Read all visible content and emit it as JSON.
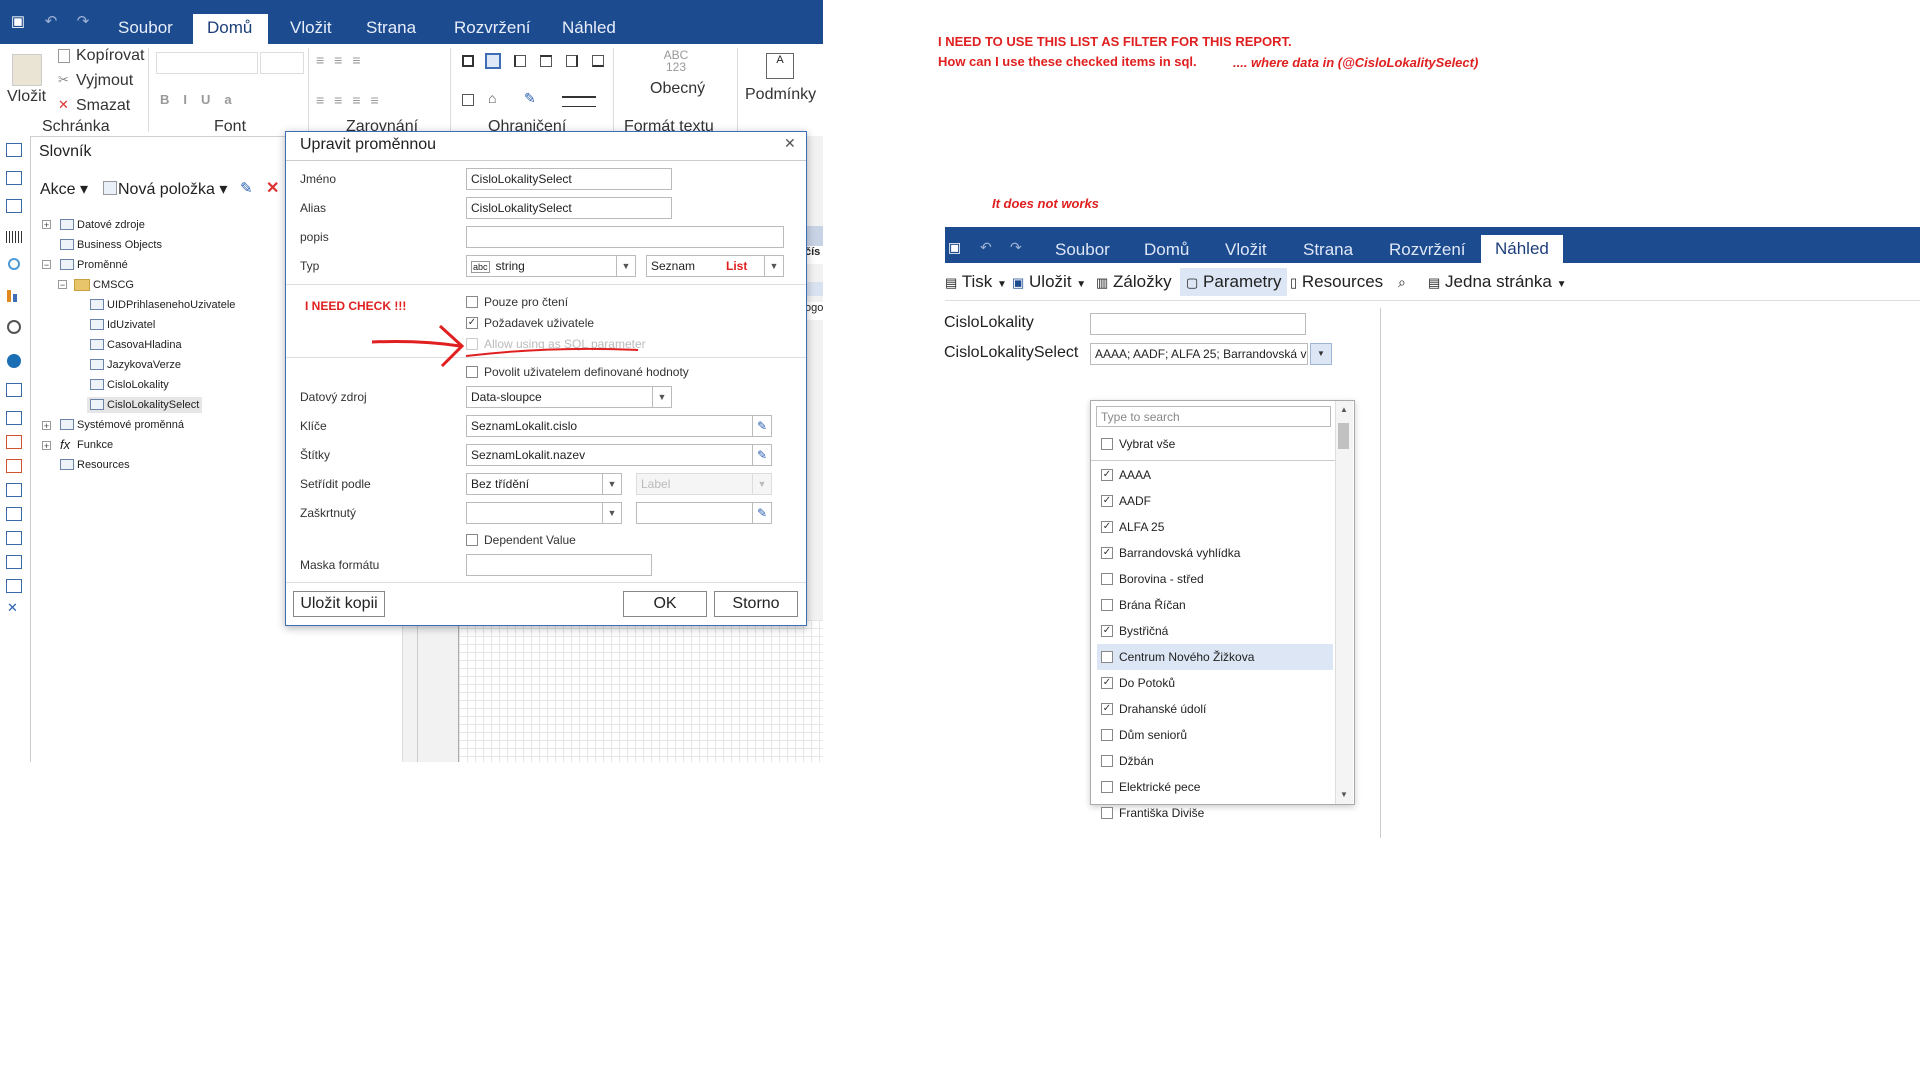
{
  "designer": {
    "menu_tabs": [
      "Soubor",
      "Domů",
      "Vložit",
      "Strana",
      "Rozvržení",
      "Náhled"
    ],
    "clipboard": {
      "paste": "Vložit",
      "copy": "Kopírovat",
      "cut": "Vyjmout",
      "delete": "Smazat",
      "group": "Schránka"
    },
    "font_group": "Font",
    "align_group": "Zarovnání",
    "border_group": "Ohraničení",
    "text_format": {
      "sample": "ABC 123",
      "label": "Obecný",
      "group": "Formát textu"
    },
    "conditions": "Podmínky",
    "dictionary": {
      "title": "Slovník",
      "actions": "Akce",
      "new_item": "Nová položka",
      "tree": {
        "datasources": "Datové zdroje",
        "business_objects": "Business Objects",
        "variables": "Proměnné",
        "category": "CMSCG",
        "vars": [
          "UIDPrihlasenehoUzivatele",
          "IdUzivatel",
          "CasovaHladina",
          "JazykovaVerze",
          "CisloLokality",
          "CisloLokalitySelect"
        ],
        "system_vars": "Systémové proměnná",
        "functions": "Funkce",
        "resources": "Resources"
      }
    },
    "page_peek": [
      "čís",
      "ogo"
    ]
  },
  "dialog": {
    "title": "Upravit proměnnou",
    "name_label": "Jméno",
    "name_value": "CisloLokalitySelect",
    "alias_label": "Alias",
    "alias_value": "CisloLokalitySelect",
    "desc_label": "popis",
    "desc_value": "",
    "type_label": "Typ",
    "type_value": "string",
    "type_kind": "Seznam",
    "readonly_label": "Pouze pro čtení",
    "request_label": "Požadavek uživatele",
    "sqlparam_label": "Allow using as SQL parameter",
    "userdef_label": "Povolit uživatelem definované hodnoty",
    "datasource_label": "Datový zdroj",
    "datasource_value": "Data-sloupce",
    "keys_label": "Klíče",
    "keys_value": "SeznamLokalit.cislo",
    "labels_label": "Štítky",
    "labels_value": "SeznamLokalit.nazev",
    "sort_label": "Setřídit podle",
    "sort_value": "Bez třídění",
    "sort_extra": "Label",
    "checked_label": "Zaškrtnutý",
    "dependent_label": "Dependent Value",
    "mask_label": "Maska formátu",
    "save_copy": "Uložit kopii",
    "ok": "OK",
    "cancel": "Storno"
  },
  "annotations": {
    "list_red": "List",
    "need_check": "I NEED CHECK !!!",
    "line1": "I NEED TO USE THIS LIST AS FILTER FOR THIS REPORT.",
    "line2": "How can I use these checked items in sql.",
    "line2b": ".... where data in (@CisloLokalitySelect)",
    "not_works": "It does not works"
  },
  "viewer": {
    "tabs": [
      "Soubor",
      "Domů",
      "Vložit",
      "Strana",
      "Rozvržení",
      "Náhled"
    ],
    "toolbar": {
      "print": "Tisk",
      "save": "Uložit",
      "bookmarks": "Záložky",
      "params": "Parametry",
      "resources": "Resources",
      "single_page": "Jedna stránka"
    },
    "param1_label": "CisloLokality",
    "param1_value": "",
    "param2_label": "CisloLokalitySelect",
    "param2_value": "AAAA; AADF; ALFA 25; Barrandovská v",
    "search_placeholder": "Type to search",
    "select_all": "Vybrat vše",
    "items": [
      {
        "label": "AAAA",
        "checked": true
      },
      {
        "label": "AADF",
        "checked": true
      },
      {
        "label": "ALFA 25",
        "checked": true
      },
      {
        "label": "Barrandovská vyhlídka",
        "checked": true
      },
      {
        "label": "Borovina - střed",
        "checked": false
      },
      {
        "label": "Brána Říčan",
        "checked": false
      },
      {
        "label": "Bystřičná",
        "checked": true
      },
      {
        "label": "Centrum Nového Žižkova",
        "checked": false
      },
      {
        "label": "Do Potoků",
        "checked": true
      },
      {
        "label": "Drahanské údolí",
        "checked": true
      },
      {
        "label": "Dům seniorů",
        "checked": false
      },
      {
        "label": "Džbán",
        "checked": false
      },
      {
        "label": "Elektrické pece",
        "checked": false
      },
      {
        "label": "Františka Diviše",
        "checked": false
      }
    ],
    "colors": {
      "bar": "#1c4b8f",
      "highlight": "#dce6f4",
      "red": "#e02020"
    }
  }
}
